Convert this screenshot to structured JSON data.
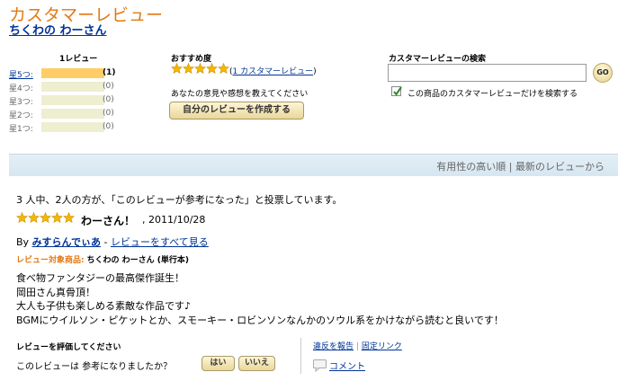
{
  "header": {
    "title": "カスタマーレビュー",
    "product": "ちくわの わーさん"
  },
  "histogram": {
    "title": "1レビュー",
    "rows": [
      {
        "label": "星5つ:",
        "count": "(1)",
        "fraction": 1.0,
        "linked": true
      },
      {
        "label": "星4つ:",
        "count": "(0)",
        "fraction": 0,
        "linked": false
      },
      {
        "label": "星3つ:",
        "count": "(0)",
        "fraction": 0,
        "linked": false
      },
      {
        "label": "星2つ:",
        "count": "(0)",
        "fraction": 0,
        "linked": false
      },
      {
        "label": "星1つ:",
        "count": "(0)",
        "fraction": 0,
        "linked": false
      }
    ]
  },
  "recommend": {
    "title": "おすすめ度",
    "stars": 5,
    "count_open": "(",
    "count_link": "1 カスタマーレビュー",
    "count_close": ")",
    "prompt": "あなたの意見や感想を教えてください",
    "write_button": "自分のレビューを作成する"
  },
  "search": {
    "title": "カスタマーレビューの検索",
    "value": "",
    "go_label": "GO",
    "checkbox_checked": true,
    "checkbox_label": "この商品のカスタマーレビューだけを検索する"
  },
  "sort": {
    "text": "有用性の高い順 | 最新のレビューから"
  },
  "review": {
    "votes": "3 人中、2人の方が、「このレビューが参考になった」と投票しています。",
    "stars": 5,
    "title": "わーさん！",
    "date": ", 2011/10/28",
    "by": "By",
    "author": "みすらんでぃあ",
    "sep": " - ",
    "all_reviews": "レビューをすべて見る",
    "target_label": "レビュー対象商品:",
    "target_product": "ちくわの わーさん (単行本)",
    "body": [
      "食べ物ファンタジーの最高傑作誕生！",
      "岡田さん真骨頂！",
      "大人も子供も楽しめる素敵な作品です♪",
      "BGMにウイルソン・ピケットとか、スモーキー・ロビンソンなんかのソウル系をかけながら読むと良いです！"
    ]
  },
  "rating": {
    "title": "レビューを評価してください",
    "question": "このレビューは 参考になりましたか？",
    "yes": "はい",
    "no": "いいえ",
    "report": "違反を報告",
    "separator": "|",
    "permalink": "固定リンク",
    "comment": "コメント"
  },
  "colors": {
    "title_orange": "#e47911",
    "link_blue": "#003399",
    "star_gold": "#f5b700",
    "bar_fill": "#ffcc66",
    "sort_bar": "#dce9f3"
  }
}
